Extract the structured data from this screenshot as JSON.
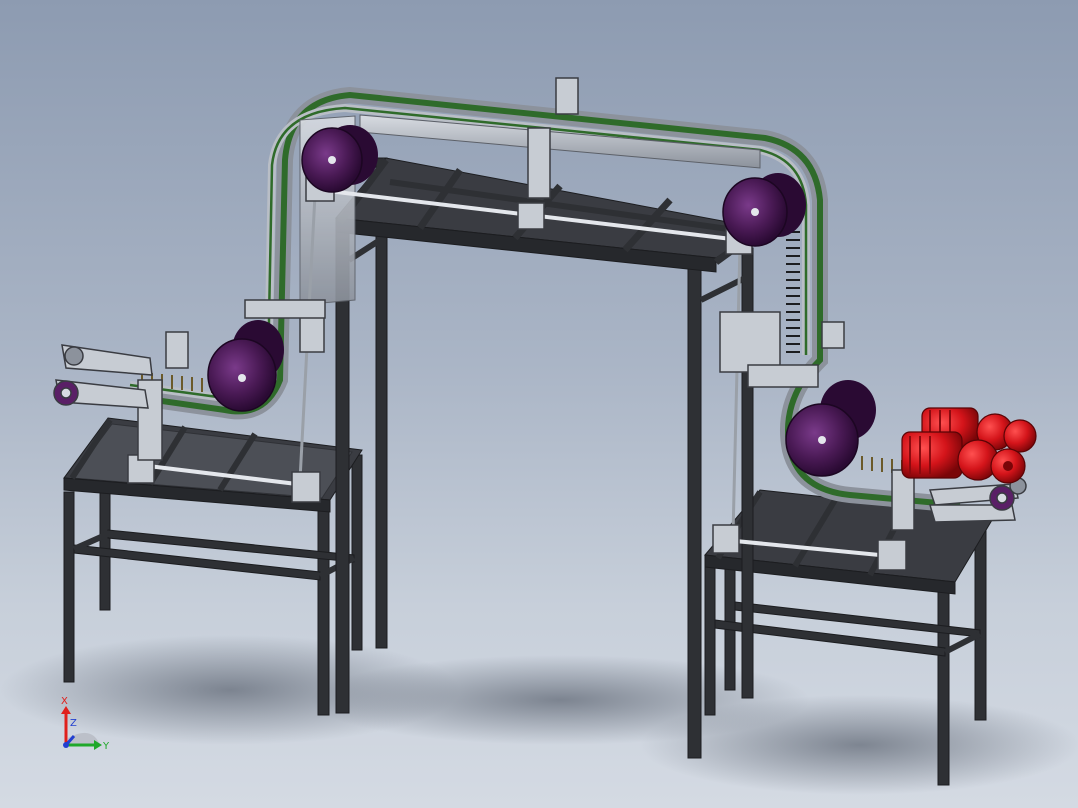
{
  "colors": {
    "background_top": "#8d9bb1",
    "background_bottom": "#d4dae3",
    "frame": "#2e3034",
    "aluminum": "#b9bec6",
    "belt_green": "#2f6b2a",
    "drum_purple": "#4a1a55",
    "motor_red": "#d4141a",
    "axis_x": "#e0201c",
    "axis_y": "#1fa82a",
    "axis_z": "#2340d0"
  },
  "icons": {
    "motor": "gear-motor-icon",
    "drum": "pulley-drum-icon"
  },
  "triad": {
    "x_label": "X",
    "y_label": "Y",
    "z_label": "Z"
  }
}
